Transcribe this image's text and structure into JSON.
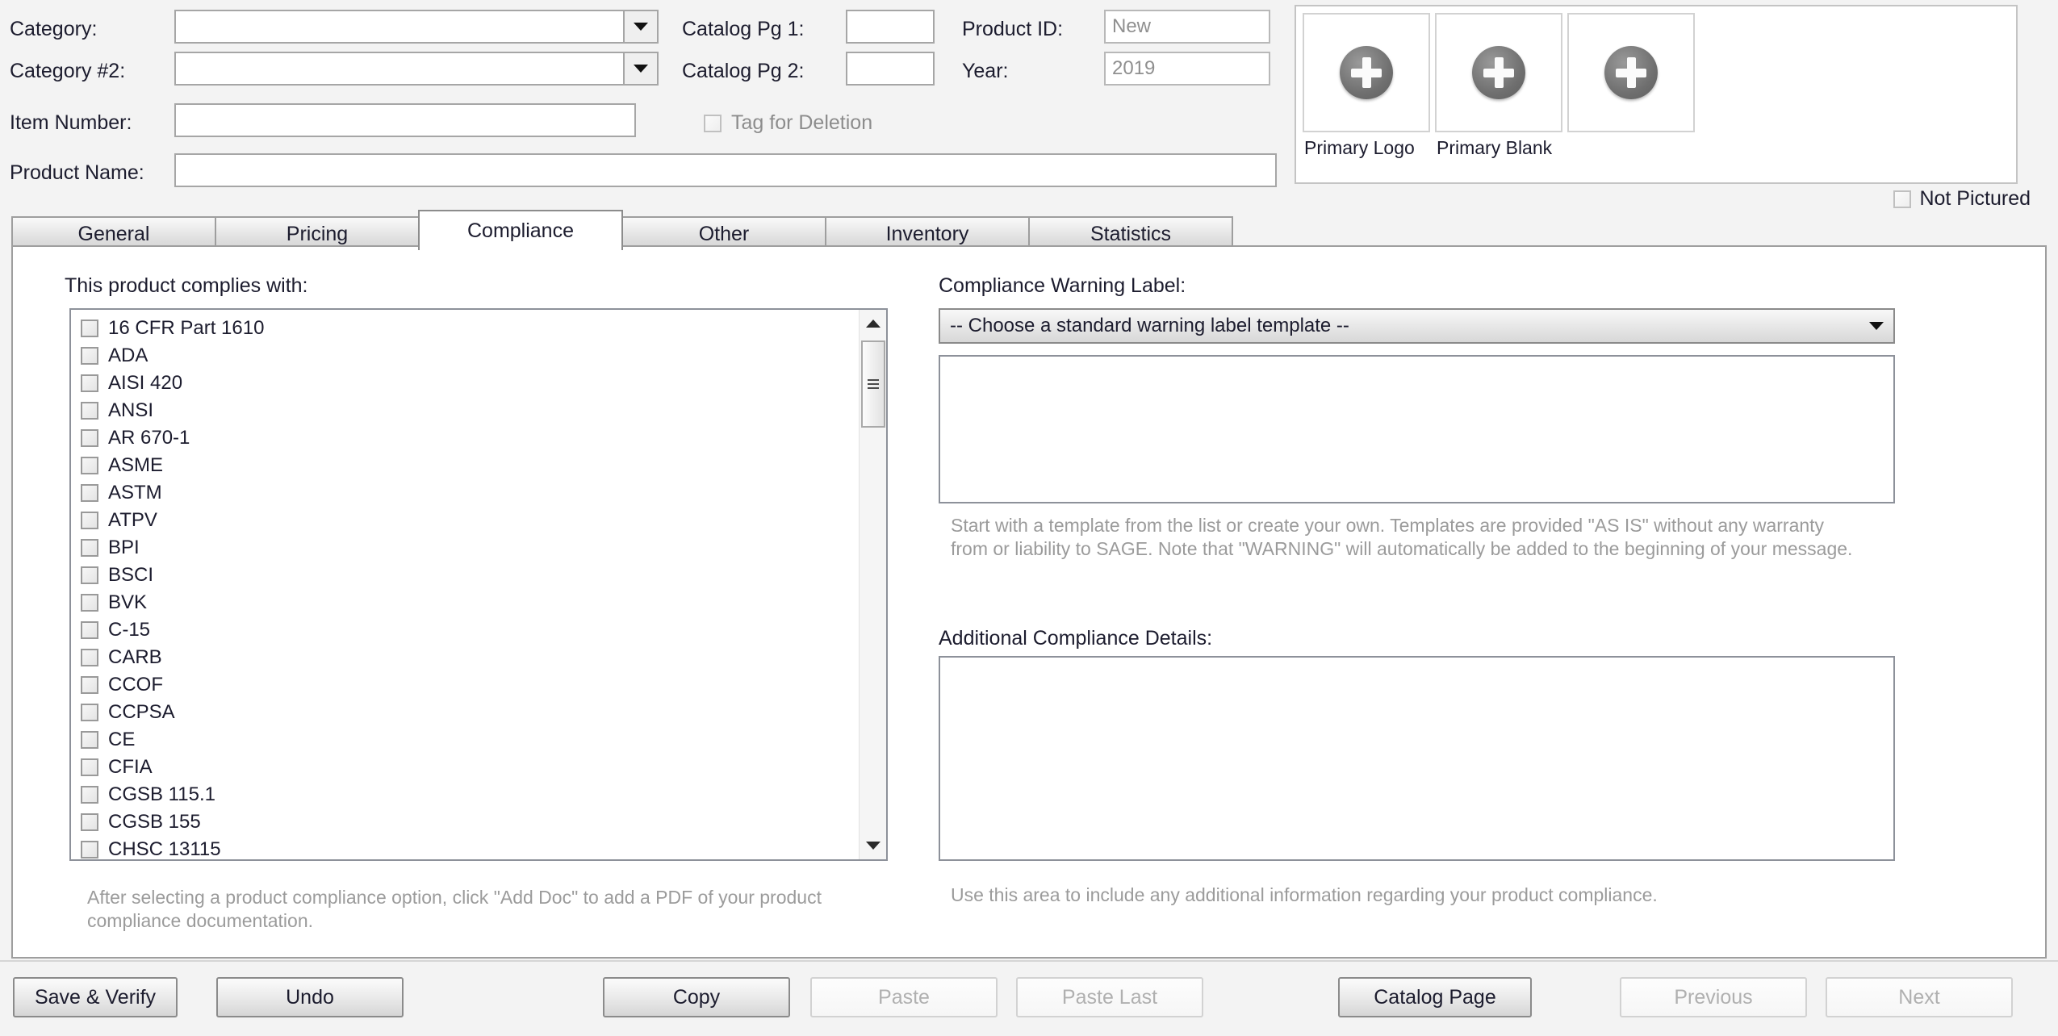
{
  "header": {
    "category_label": "Category:",
    "category_value": "",
    "category2_label": "Category #2:",
    "category2_value": "",
    "item_number_label": "Item Number:",
    "item_number_value": "",
    "product_name_label": "Product Name:",
    "product_name_value": "",
    "catalog_pg1_label": "Catalog Pg 1:",
    "catalog_pg1_value": "",
    "catalog_pg2_label": "Catalog Pg 2:",
    "catalog_pg2_value": "",
    "product_id_label": "Product ID:",
    "product_id_value": "New",
    "year_label": "Year:",
    "year_value": "2019",
    "tag_for_deletion_label": "Tag for Deletion"
  },
  "images": {
    "thumbnails": [
      {
        "caption": "Primary Logo"
      },
      {
        "caption": "Primary Blank"
      },
      {
        "caption": ""
      }
    ],
    "not_pictured_label": "Not Pictured"
  },
  "tabs": [
    {
      "label": "General",
      "active": false
    },
    {
      "label": "Pricing",
      "active": false
    },
    {
      "label": "Compliance",
      "active": true
    },
    {
      "label": "Other",
      "active": false
    },
    {
      "label": "Inventory",
      "active": false
    },
    {
      "label": "Statistics",
      "active": false
    }
  ],
  "compliance": {
    "list_label": "This product complies with:",
    "items": [
      "16 CFR Part 1610",
      "ADA",
      "AISI 420",
      "ANSI",
      "AR 670-1",
      "ASME",
      "ASTM",
      "ATPV",
      "BPI",
      "BSCI",
      "BVK",
      "C-15",
      "CARB",
      "CCOF",
      "CCPSA",
      "CE",
      "CFIA",
      "CGSB 115.1",
      "CGSB 155",
      "CHSC 13115"
    ],
    "list_help": "After selecting a product compliance option, click \"Add Doc\" to add a PDF of your product compliance documentation.",
    "warning_label_title": "Compliance Warning Label:",
    "warning_template_selected": "-- Choose a standard warning label template --",
    "warning_text_value": "",
    "warning_help": "Start with a template from the list or create your own.  Templates are provided \"AS IS\" without any warranty from or liability to SAGE.  Note that \"WARNING\" will automatically be added to the beginning of your message.",
    "additional_details_title": "Additional Compliance Details:",
    "additional_details_value": "",
    "additional_details_help": "Use this area to include any additional information regarding your product compliance."
  },
  "buttons": [
    {
      "label": "Save & Verify",
      "disabled": false
    },
    {
      "label": "Undo",
      "disabled": false
    },
    {
      "label": "Copy",
      "disabled": false
    },
    {
      "label": "Paste",
      "disabled": true
    },
    {
      "label": "Paste Last",
      "disabled": true
    },
    {
      "label": "Catalog Page",
      "disabled": false
    },
    {
      "label": "Previous",
      "disabled": true
    },
    {
      "label": "Next",
      "disabled": true
    }
  ]
}
